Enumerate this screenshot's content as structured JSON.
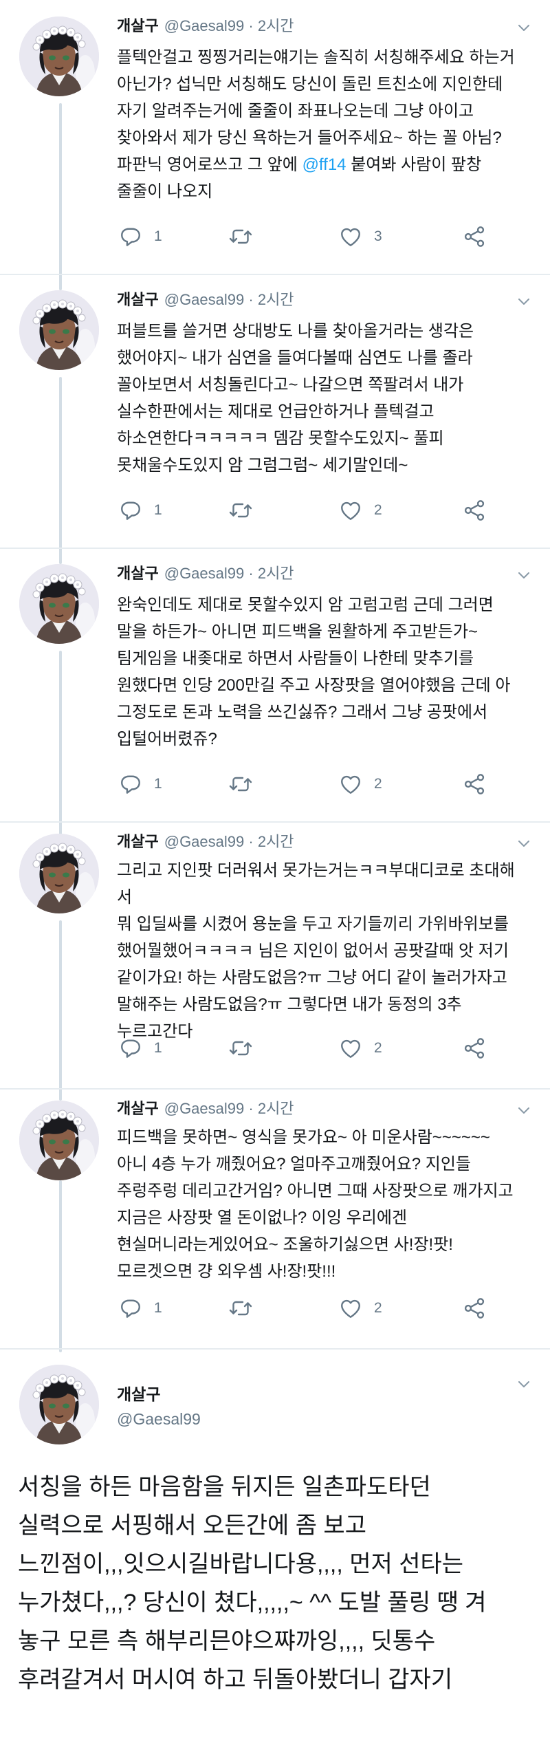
{
  "tweets": [
    {
      "name": "개살구",
      "handle": "@Gaesal99",
      "sep": "·",
      "time": "2시간",
      "text_a": "플텍안걸고 찡찡거리는얘기는 솔직히 서칭해주세요 하는거\n아닌가? 섭닉만 서칭해도 당신이 돌린 트친소에 지인한테\n자기 알려주는거에 줄줄이 좌표나오는데 그냥 아이고\n찾아와서 제가 당신 욕하는거 들어주세요~ 하는 꼴 아님?\n파판닉 영어로쓰고 그 앞에 ",
      "mention": "@ff14",
      "text_b": " 붙여봐 사람이 팦창\n줄줄이 나오지",
      "replies": "1",
      "retweets": "",
      "likes": "3"
    },
    {
      "name": "개살구",
      "handle": "@Gaesal99",
      "sep": "·",
      "time": "2시간",
      "text": "퍼블트를 쓸거면 상대방도 나를 찾아올거라는 생각은\n했어야지~ 내가 심연을 들여다볼때 심연도 나를 졸라\n꼴아보면서 서칭돌린다고~ 나갈으면 쪽팔려서 내가\n실수한판에서는 제대로 언급안하거나 플텍걸고\n하소연한다ㅋㅋㅋㅋㅋ 뎀감 못할수도있지~ 풀피\n못채울수도있지 암 그럼그럼~ 세기말인데~",
      "replies": "1",
      "retweets": "",
      "likes": "2"
    },
    {
      "name": "개살구",
      "handle": "@Gaesal99",
      "sep": "·",
      "time": "2시간",
      "text": "완숙인데도 제대로 못할수있지 암 고럼고럼 근데 그러면\n말을 하든가~ 아니면 피드백을 원활하게 주고받든가~\n팀게임을 내좆대로 하면서 사람들이 나한테 맞추기를\n원했다면 인당 200만길 주고 사장팟을 열어야했음 근데 아\n그정도로 돈과 노력을 쓰긴싫쥬? 그래서 그냥 공팟에서\n입털어버렸쥬?",
      "replies": "1",
      "retweets": "",
      "likes": "2"
    },
    {
      "name": "개살구",
      "handle": "@Gaesal99",
      "sep": "·",
      "time": "2시간",
      "text": "그리고 지인팟 더러워서 못가는거는ㅋㅋ부대디코로 초대해서\n뭐 입딜싸를 시켰어 용눈을 두고 자기들끼리 가위바위보를\n했어뭘했어ㅋㅋㅋㅋ 님은 지인이 없어서 공팟갈때 앗 저기\n같이가요! 하는 사람도없음?ㅠ 그냥 어디 같이 놀러가자고\n말해주는 사람도없음?ㅠ 그렇다면 내가 동정의 3추\n누르고간다",
      "replies": "1",
      "retweets": "",
      "likes": "2"
    },
    {
      "name": "개살구",
      "handle": "@Gaesal99",
      "sep": "·",
      "time": "2시간",
      "text": "피드백을 못하면~ 영식을 못가요~ 아 미운사람~~~~~~\n아니 4층 누가 깨줬어요? 얼마주고깨줬어요? 지인들\n주렁주렁 데리고간거임? 아니면 그때 사장팟으로 깨가지고\n지금은 사장팟 열 돈이없나? 이잉 우리에겐\n현실머니라는게있어요~ 조울하기싫으면 사!장!팟!\n모르겟으면 걍 외우셈 사!장!팟!!!",
      "replies": "1",
      "retweets": "",
      "likes": "2"
    }
  ],
  "final": {
    "name": "개살구",
    "handle": "@Gaesal99",
    "text": "서칭을 하든 마음함을 뒤지든 일촌파도타던\n실력으로 서핑해서 오든간에 좀 보고\n느낀점이,,,잇으시길바랍니다용,,,, 먼저 선타는\n누가쳤다,,,? 당신이 쳤다,,,,,~ ^^ 도발 풀링 땡 겨\n놓구 모른 측 해부리믄야으쨔까잉,,,,  딧통수\n후려갈겨서 머시여 하고 뒤돌아봤더니 갑자기"
  },
  "colors": {
    "text": "#14171a",
    "secondary": "#657786",
    "link": "#1da1f2",
    "thread_line": "#d3dde5"
  },
  "icons": [
    "reply-icon",
    "retweet-icon",
    "like-icon",
    "share-icon",
    "chevron-down-icon",
    "avatar"
  ]
}
